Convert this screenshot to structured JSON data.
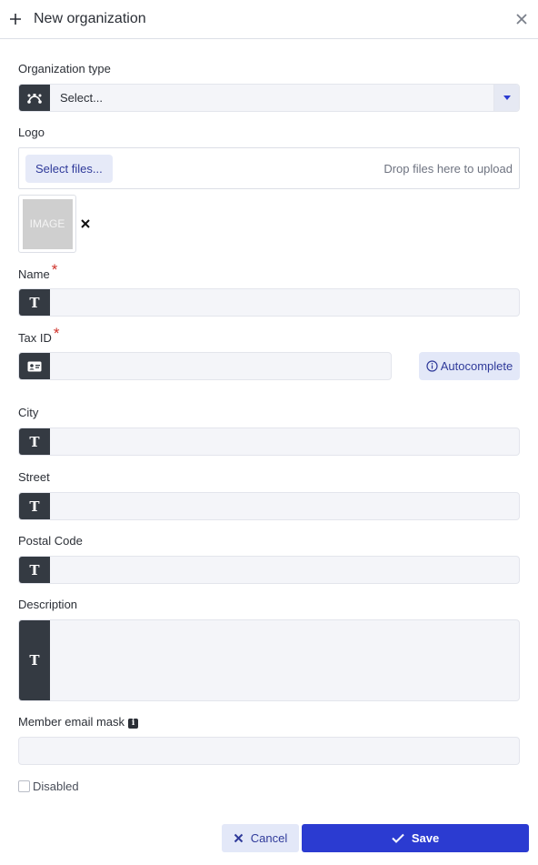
{
  "header": {
    "title": "New organization",
    "plus_icon": "plus-icon",
    "close_icon": "close-icon"
  },
  "form": {
    "org_type": {
      "label": "Organization type",
      "value": "Select...",
      "icon": "bezier-curve-icon"
    },
    "logo": {
      "label": "Logo",
      "select_files": "Select files...",
      "drop_text": "Drop files here to upload",
      "thumbnail_text": "IMAGE"
    },
    "name": {
      "label": "Name",
      "required": "*",
      "value": ""
    },
    "tax_id": {
      "label": "Tax ID",
      "required": "*",
      "value": "",
      "autocomplete": "Autocomplete"
    },
    "city": {
      "label": "City",
      "value": ""
    },
    "street": {
      "label": "Street",
      "value": ""
    },
    "postal_code": {
      "label": "Postal Code",
      "value": ""
    },
    "description": {
      "label": "Description",
      "value": ""
    },
    "email_mask": {
      "label": "Member email mask",
      "info": "i",
      "value": ""
    },
    "disabled": {
      "label": "Disabled",
      "checked": false
    }
  },
  "actions": {
    "cancel": "Cancel",
    "save": "Save"
  },
  "colors": {
    "primary": "#2b3bd1",
    "secondary_bg": "#e3e8f8",
    "icon_bg": "#343a42",
    "required": "#d0332b"
  }
}
